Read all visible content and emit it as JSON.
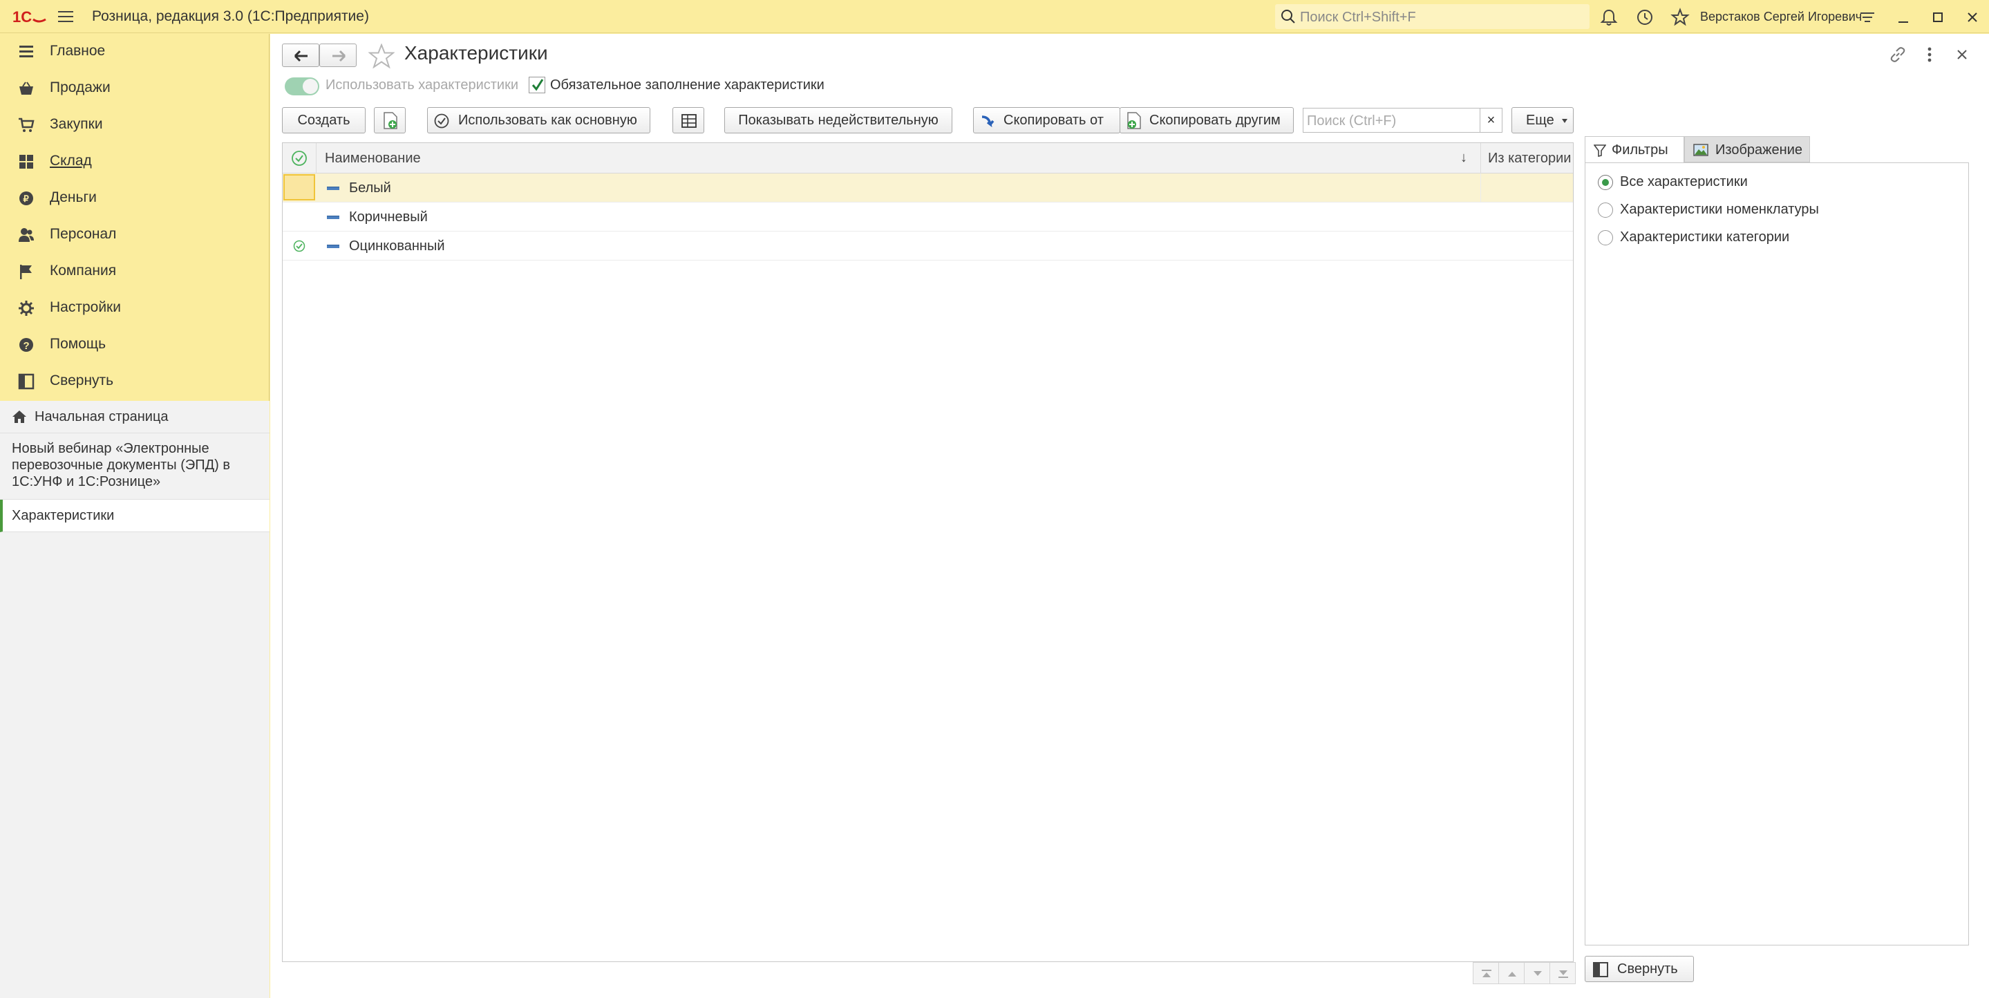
{
  "app": {
    "title": "Розница, редакция 3.0  (1С:Предприятие)",
    "search_placeholder": "Поиск Ctrl+Shift+F",
    "user": "Верстаков Сергей Игоревич"
  },
  "sidebar": {
    "items": [
      {
        "label": "Главное",
        "icon": "list-icon"
      },
      {
        "label": "Продажи",
        "icon": "basket-icon"
      },
      {
        "label": "Закупки",
        "icon": "cart-icon"
      },
      {
        "label": "Склад",
        "icon": "grid-icon"
      },
      {
        "label": "Деньги",
        "icon": "coin-icon"
      },
      {
        "label": "Персонал",
        "icon": "people-icon"
      },
      {
        "label": "Компания",
        "icon": "flag-icon"
      },
      {
        "label": "Настройки",
        "icon": "gear-icon"
      },
      {
        "label": "Помощь",
        "icon": "help-icon"
      },
      {
        "label": "Свернуть",
        "icon": "panel-collapse-icon"
      }
    ],
    "open_windows": {
      "home": "Начальная страница",
      "webinar": "Новый вебинар «Электронные перевозочные документы (ЭПД) в 1С:УНФ и 1С:Рознице»",
      "current": "Характеристики"
    }
  },
  "form": {
    "title": "Характеристики",
    "use_characteristics_label": "Использовать характеристики",
    "mandatory_fill_label": "Обязательное заполнение характеристики",
    "mandatory_fill_checked": true
  },
  "toolbar": {
    "create": "Создать",
    "use_as_main": "Использовать как основную",
    "show_invalid": "Показывать недействительную",
    "copy_from": "Скопировать от",
    "copy_to_others": "Скопировать другим",
    "search_placeholder": "Поиск (Ctrl+F)",
    "search_clear": "×",
    "more": "Еще"
  },
  "table": {
    "columns": [
      "Наименование",
      "Из категории"
    ],
    "sort_indicator": "↓",
    "rows": [
      {
        "name": "Белый",
        "selected": true,
        "main": false
      },
      {
        "name": "Коричневый",
        "selected": false,
        "main": false
      },
      {
        "name": "Оцинкованный",
        "selected": false,
        "main": true
      }
    ]
  },
  "panel": {
    "tabs": [
      "Фильтры",
      "Изображение"
    ],
    "filters": [
      {
        "label": "Все характеристики",
        "checked": true
      },
      {
        "label": "Характеристики номенклатуры",
        "checked": false
      },
      {
        "label": "Характеристики категории",
        "checked": false
      }
    ],
    "collapse": "Свернуть"
  }
}
